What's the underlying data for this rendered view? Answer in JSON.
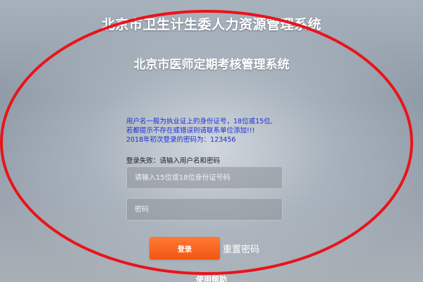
{
  "header": {
    "title": "北京市卫生计生委人力资源管理系统",
    "subtitle": "北京市医师定期考核管理系统"
  },
  "notice": {
    "line1": "用户名一般为执业证上的身份证号，18位或15位,",
    "line2": "若都提示不存在或错误则请联系单位添加!!!",
    "line3": "2018年初次登录的密码为：123456",
    "color": "#1a2fd6"
  },
  "login": {
    "error_message": "登录失败：请输入用户名和密码",
    "username_placeholder": "请输入15位或18位身份证号码",
    "password_placeholder": "密码",
    "login_label": "登录",
    "reset_password_label": "重置密码",
    "help_label": "使用帮助",
    "accent_color": "#f25612"
  },
  "annotation": {
    "shape": "ellipse",
    "color": "#e8141c"
  }
}
